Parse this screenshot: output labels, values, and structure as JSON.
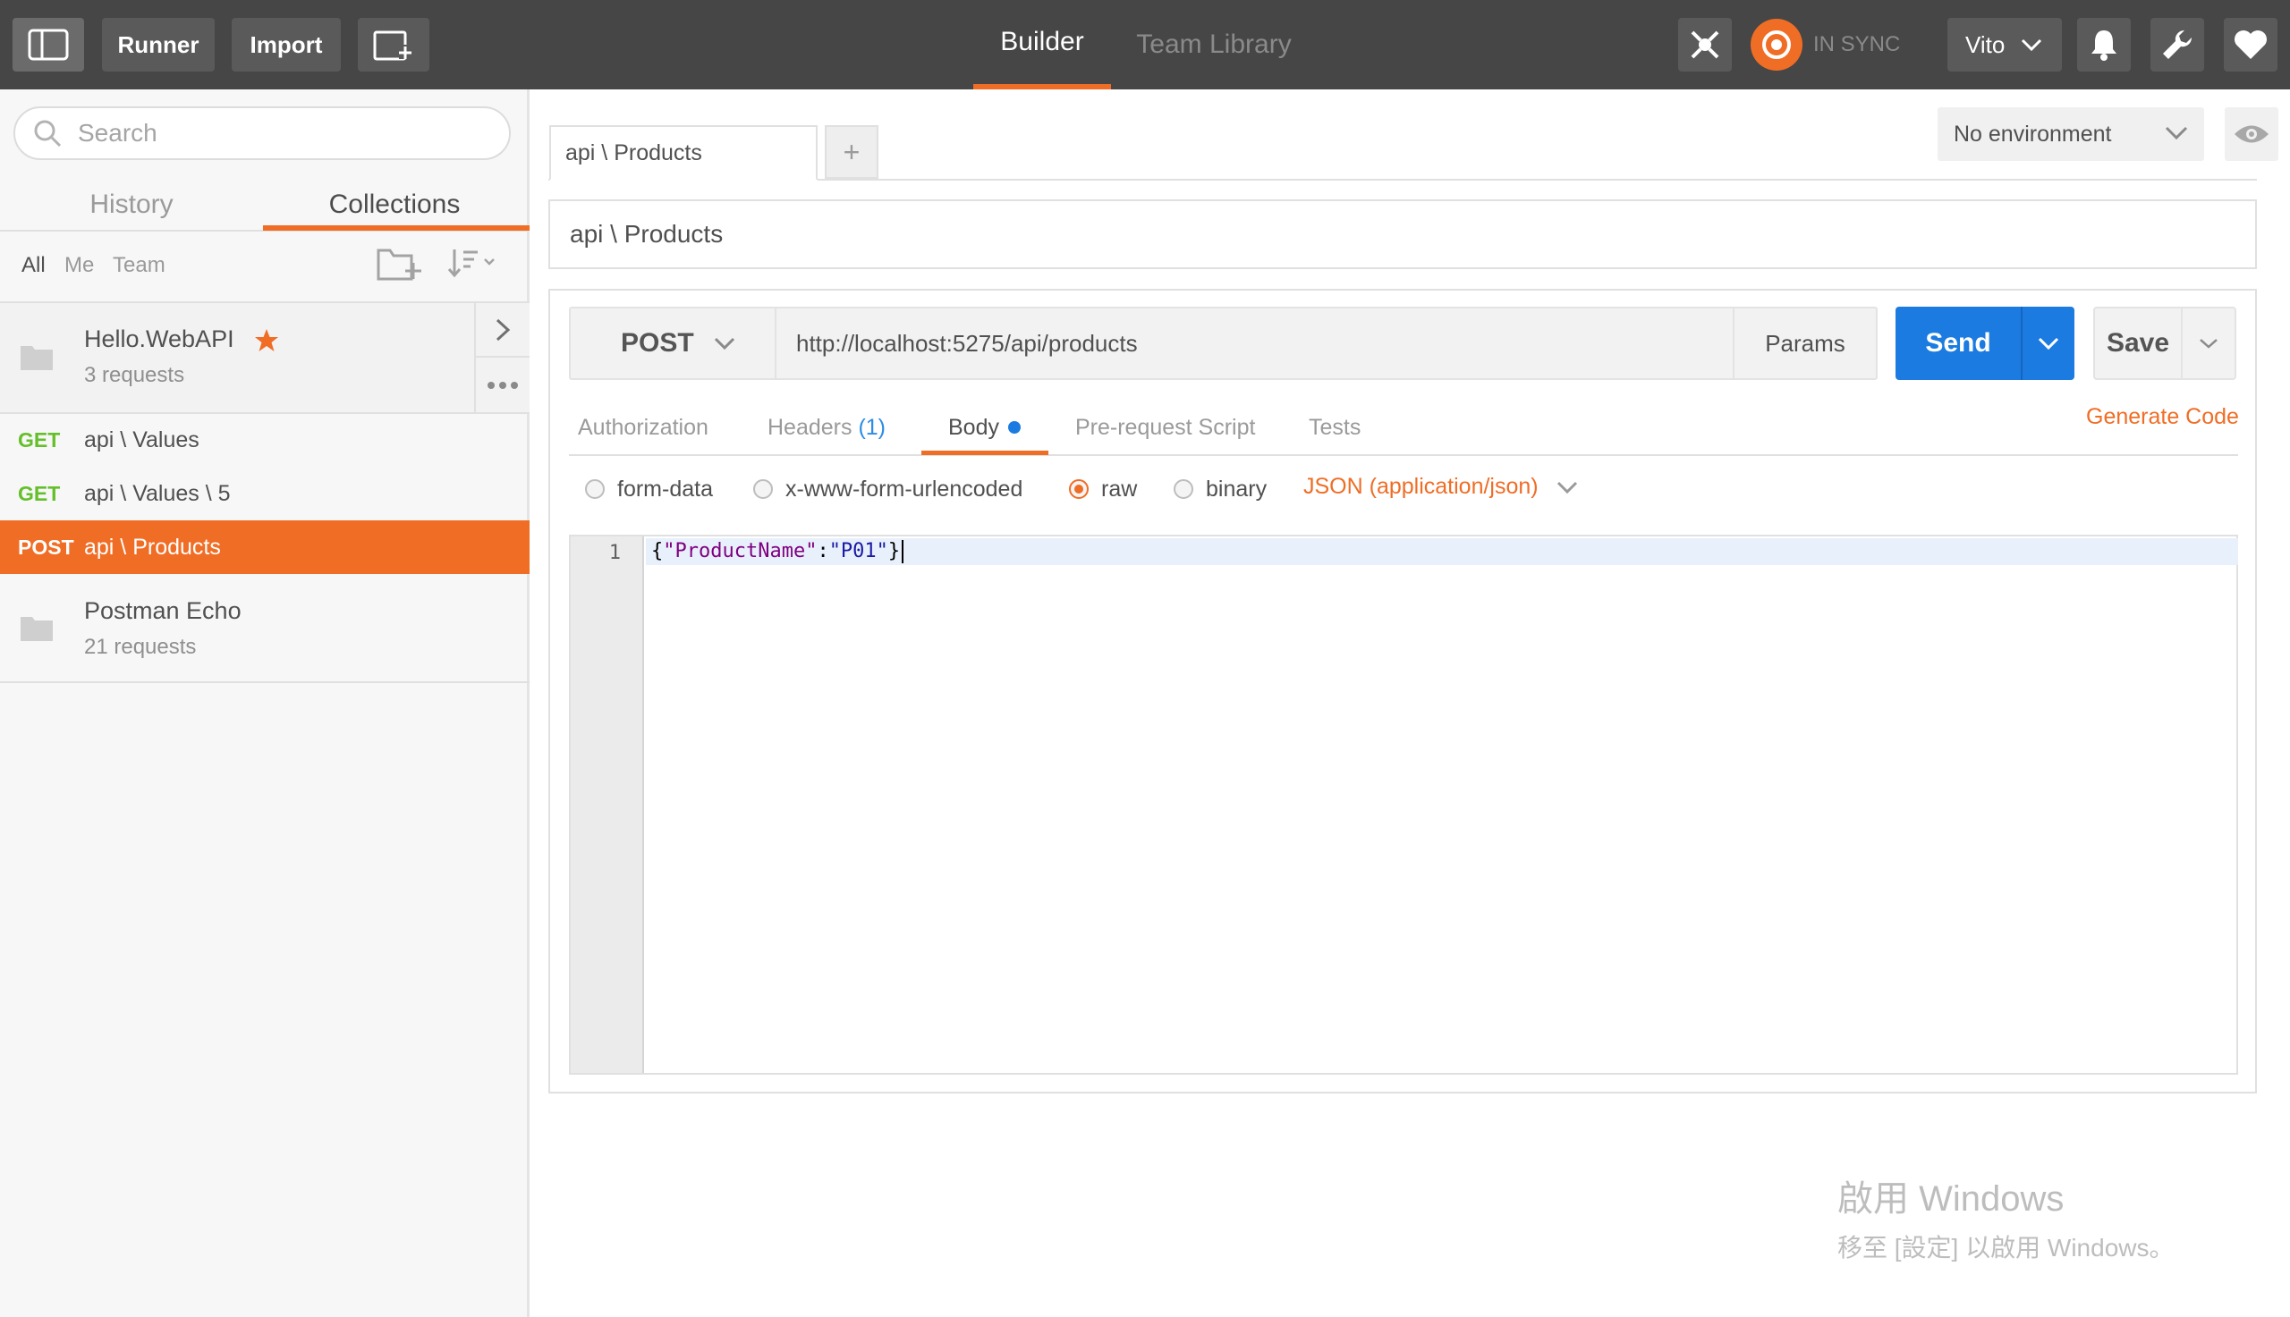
{
  "topbar": {
    "runner_label": "Runner",
    "import_label": "Import",
    "nav_builder": "Builder",
    "nav_team_library": "Team Library",
    "sync_status": "IN SYNC",
    "user_name": "Vito",
    "accent_color": "#f06d25"
  },
  "sidebar": {
    "search_placeholder": "Search",
    "tab_history": "History",
    "tab_collections": "Collections",
    "filter_all": "All",
    "filter_me": "Me",
    "filter_team": "Team",
    "collections": [
      {
        "name": "Hello.WebAPI",
        "count": "3 requests",
        "starred": true
      },
      {
        "name": "Postman Echo",
        "count": "21 requests",
        "starred": false
      }
    ],
    "requests": [
      {
        "method": "GET",
        "name": "api \\ Values"
      },
      {
        "method": "GET",
        "name": "api \\ Values \\ 5"
      },
      {
        "method": "POST",
        "name": "api \\ Products"
      }
    ]
  },
  "main": {
    "tab_label": "api \\ Products",
    "add_tab_label": "+",
    "environment": "No environment",
    "request_name": "api \\ Products",
    "method": "POST",
    "url": "http://localhost:5275/api/products",
    "params_label": "Params",
    "send_label": "Send",
    "save_label": "Save",
    "subtabs": {
      "authorization": "Authorization",
      "headers": "Headers",
      "headers_count": "(1)",
      "body": "Body",
      "pre_request": "Pre-request Script",
      "tests": "Tests"
    },
    "generate_code": "Generate Code",
    "body_modes": {
      "form_data": "form-data",
      "urlencoded": "x-www-form-urlencoded",
      "raw": "raw",
      "binary": "binary"
    },
    "content_type": "JSON (application/json)",
    "editor": {
      "line_number": "1",
      "open_brace": "{",
      "key": "\"ProductName\"",
      "colon": ":",
      "value": "\"P01\"",
      "close_brace": "}"
    }
  },
  "watermark": {
    "title": "啟用 Windows",
    "subtitle": "移至 [設定] 以啟用 Windows。"
  }
}
